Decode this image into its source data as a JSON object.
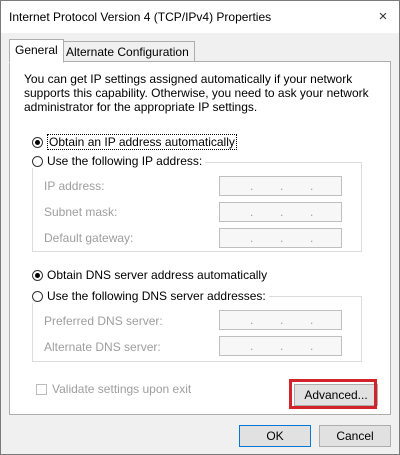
{
  "window": {
    "title": "Internet Protocol Version 4 (TCP/IPv4) Properties",
    "close_glyph": "×"
  },
  "tabs": [
    {
      "label": "General",
      "active": true
    },
    {
      "label": "Alternate Configuration",
      "active": false
    }
  ],
  "general": {
    "description": "You can get IP settings assigned automatically if your network supports this capability. Otherwise, you need to ask your network administrator for the appropriate IP settings.",
    "ip_mode": {
      "auto_label": "Obtain an IP address automatically",
      "manual_label": "Use the following IP address:",
      "selected": "auto"
    },
    "ip_fields": [
      {
        "label": "IP address:",
        "value": " .  .  ."
      },
      {
        "label": "Subnet mask:",
        "value": " .  .  ."
      },
      {
        "label": "Default gateway:",
        "value": " .  .  ."
      }
    ],
    "dns_mode": {
      "auto_label": "Obtain DNS server address automatically",
      "manual_label": "Use the following DNS server addresses:",
      "selected": "auto"
    },
    "dns_fields": [
      {
        "label": "Preferred DNS server:",
        "value": " .  .  ."
      },
      {
        "label": "Alternate DNS server:",
        "value": " .  .  ."
      }
    ],
    "validate_label": "Validate settings upon exit",
    "advanced_label": "Advanced..."
  },
  "footer": {
    "ok_label": "OK",
    "cancel_label": "Cancel"
  },
  "colors": {
    "highlight": "#d2232a",
    "default_button_border": "#0078d7"
  }
}
